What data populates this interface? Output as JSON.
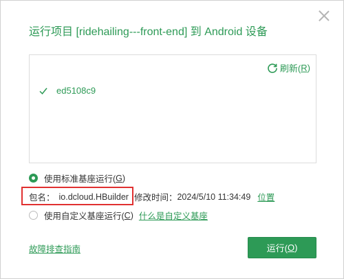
{
  "dialog": {
    "title": "运行项目 [ridehailing---front-end] 到 Android 设备"
  },
  "devices": {
    "refresh_label": "刷新(",
    "refresh_key": "R",
    "refresh_suffix": ")",
    "items": [
      {
        "name": "ed5108c9",
        "selected": true
      }
    ]
  },
  "base": {
    "standard_label": "使用标准基座运行(",
    "standard_key": "G",
    "standard_suffix": ")",
    "standard_selected": true,
    "package_label": "包名：",
    "package_value": "io.dcloud.HBuilder",
    "modified_label": "修改时间：",
    "modified_value": "2024/5/10 11:34:49",
    "location_link": "位置",
    "custom_label": "使用自定义基座运行(",
    "custom_key": "C",
    "custom_suffix": ")",
    "custom_selected": false,
    "custom_help_link": "什么是自定义基座"
  },
  "footer": {
    "troubleshoot_link": "故障排查指南",
    "run_label": "运行(",
    "run_key": "O",
    "run_suffix": ")"
  },
  "colors": {
    "accent": "#2d9a56",
    "highlight_box": "#e03030"
  }
}
